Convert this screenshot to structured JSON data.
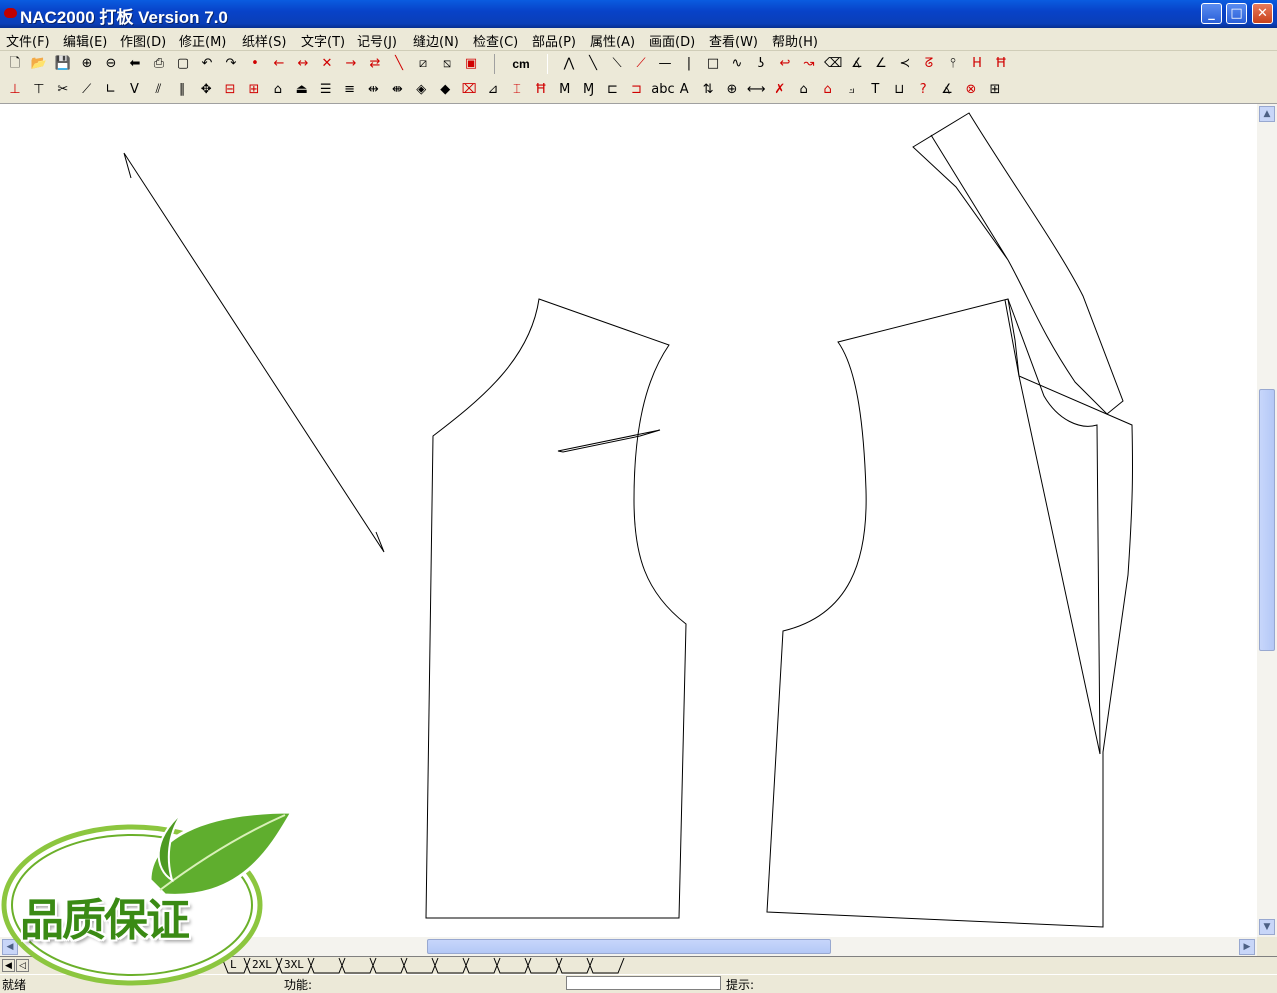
{
  "window": {
    "title": "NAC2000 打板 Version 7.0",
    "minimize": "_",
    "maximize": "□",
    "close": "✕"
  },
  "menu": [
    "文件(F)",
    "编辑(E)",
    "作图(D)",
    "修正(M)",
    "纸样(S)",
    "文字(T)",
    "记号(J)",
    "缝边(N)",
    "检查(C)",
    "部品(P)",
    "属性(A)",
    "画面(D)",
    "查看(W)",
    "帮助(H)"
  ],
  "toolbar1": {
    "tools": [
      {
        "name": "new-file-icon",
        "glyph": "🗋"
      },
      {
        "name": "open-file-icon",
        "glyph": "📂"
      },
      {
        "name": "save-icon",
        "glyph": "💾"
      },
      {
        "name": "zoom-in-icon",
        "glyph": "⊕"
      },
      {
        "name": "zoom-out-icon",
        "glyph": "⊖"
      },
      {
        "name": "back-arrow-icon",
        "glyph": "⬅"
      },
      {
        "name": "print-icon",
        "glyph": "⎙"
      },
      {
        "name": "frame-icon",
        "glyph": "▢"
      },
      {
        "name": "undo-icon",
        "glyph": "↶"
      },
      {
        "name": "redo-icon",
        "glyph": "↷"
      },
      {
        "name": "point-icon",
        "glyph": "•",
        "red": true
      },
      {
        "name": "arrow-left-red-icon",
        "glyph": "←",
        "red": true
      },
      {
        "name": "arrow-cross-red-icon",
        "glyph": "↔",
        "red": true
      },
      {
        "name": "x-red-icon",
        "glyph": "✕",
        "red": true
      },
      {
        "name": "arrow-right-red-icon",
        "glyph": "→",
        "red": true
      },
      {
        "name": "arrows-red-icon",
        "glyph": "⇄",
        "red": true
      },
      {
        "name": "diagonal-red-icon",
        "glyph": "╲",
        "red": true
      },
      {
        "name": "box-diagonal-icon",
        "glyph": "⧄"
      },
      {
        "name": "box-diagonal-2-icon",
        "glyph": "⧅"
      },
      {
        "name": "box-red-icon",
        "glyph": "▣",
        "red": true
      }
    ],
    "unit": "cm",
    "tools_right": [
      {
        "name": "zigzag-icon",
        "glyph": "⋀"
      },
      {
        "name": "slash-icon",
        "glyph": "╲"
      },
      {
        "name": "slash-double-icon",
        "glyph": "⟍"
      },
      {
        "name": "slash-red-icon",
        "glyph": "⟋",
        "red": true
      },
      {
        "name": "horizontal-line-icon",
        "glyph": "—"
      },
      {
        "name": "vertical-line-icon",
        "glyph": "|"
      },
      {
        "name": "rectangle-icon",
        "glyph": "□"
      },
      {
        "name": "curve-icon",
        "glyph": "∿"
      },
      {
        "name": "hook-icon",
        "glyph": "ʖ"
      },
      {
        "name": "curve-red-icon",
        "glyph": "↩",
        "red": true
      },
      {
        "name": "arc-red-icon",
        "glyph": "↝",
        "red": true
      },
      {
        "name": "eraser-icon",
        "glyph": "⌫"
      },
      {
        "name": "angle-icon",
        "glyph": "∡"
      },
      {
        "name": "angle-2-icon",
        "glyph": "∠"
      },
      {
        "name": "check-angle-icon",
        "glyph": "≺"
      },
      {
        "name": "hook-red-icon",
        "glyph": "ᘔ",
        "red": true
      },
      {
        "name": "split-icon",
        "glyph": "⫯"
      },
      {
        "name": "h-measure-red-icon",
        "glyph": "H",
        "red": true
      },
      {
        "name": "h-measure-2-red-icon",
        "glyph": "Ħ",
        "red": true
      }
    ]
  },
  "toolbar2": {
    "tools": [
      {
        "name": "grade-icon",
        "glyph": "⊥",
        "red": true
      },
      {
        "name": "grade-2-icon",
        "glyph": "⊤"
      },
      {
        "name": "scissors-icon",
        "glyph": "✂"
      },
      {
        "name": "line-icon",
        "glyph": "⟋"
      },
      {
        "name": "corner-icon",
        "glyph": "∟"
      },
      {
        "name": "v-icon",
        "glyph": "V"
      },
      {
        "name": "parallel-icon",
        "glyph": "⫽"
      },
      {
        "name": "parallel-2-icon",
        "glyph": "∥"
      },
      {
        "name": "move-icon",
        "glyph": "✥"
      },
      {
        "name": "align-icon",
        "glyph": "⊟",
        "red": true
      },
      {
        "name": "align-2-icon",
        "glyph": "⊞",
        "red": true
      },
      {
        "name": "stack-icon",
        "glyph": "⌂"
      },
      {
        "name": "stack-2-icon",
        "glyph": "⏏"
      },
      {
        "name": "stack-3-icon",
        "glyph": "☰"
      },
      {
        "name": "stack-4-icon",
        "glyph": "≡"
      },
      {
        "name": "mirror-icon",
        "glyph": "⇹"
      },
      {
        "name": "mirror-2-icon",
        "glyph": "⇼"
      },
      {
        "name": "rotate-icon",
        "glyph": "◈"
      },
      {
        "name": "rotate-2-icon",
        "glyph": "◆"
      },
      {
        "name": "piece-icon",
        "glyph": "⌧",
        "red": true
      },
      {
        "name": "fold-icon",
        "glyph": "⊿"
      },
      {
        "name": "notch-red-icon",
        "glyph": "⌶",
        "red": true
      },
      {
        "name": "hm-icon",
        "glyph": "Ħ",
        "red": true
      },
      {
        "name": "m-icon",
        "glyph": "M"
      },
      {
        "name": "m-2-icon",
        "glyph": "Ɱ"
      },
      {
        "name": "block-icon",
        "glyph": "⊏"
      },
      {
        "name": "block-red-icon",
        "glyph": "⊐",
        "red": true
      },
      {
        "name": "abc-icon",
        "glyph": "abc"
      },
      {
        "name": "text-a-icon",
        "glyph": "A"
      },
      {
        "name": "updown-icon",
        "glyph": "⇅"
      },
      {
        "name": "crosshair-icon",
        "glyph": "⊕"
      },
      {
        "name": "measure-icon",
        "glyph": "⟷"
      },
      {
        "name": "cross-red-icon",
        "glyph": "✗",
        "red": true
      },
      {
        "name": "shape-icon",
        "glyph": "⌂"
      },
      {
        "name": "shape-red-icon",
        "glyph": "⌂",
        "red": true
      },
      {
        "name": "curve-ruler-icon",
        "glyph": "⟓"
      },
      {
        "name": "text-t-icon",
        "glyph": "T"
      },
      {
        "name": "ruler-icon",
        "glyph": "⊔"
      },
      {
        "name": "question-red-icon",
        "glyph": "?",
        "red": true
      },
      {
        "name": "angle-measure-icon",
        "glyph": "∡"
      },
      {
        "name": "x-circle-red-icon",
        "glyph": "⊗",
        "red": true
      },
      {
        "name": "grid-icon",
        "glyph": "⊞"
      }
    ]
  },
  "size_tabs": [
    "L",
    "2XL",
    "3XL",
    "",
    "",
    "",
    "",
    "",
    "",
    "",
    "",
    "",
    ""
  ],
  "status": {
    "ready": "就绪",
    "function_label": "功能:",
    "hint_label": "提示:"
  },
  "badge": {
    "text": "品质保证"
  },
  "colors": {
    "titlebar": "#0a47d0",
    "menubar": "#ece9d8",
    "canvas": "#ffffff",
    "badge_green": "#3a8a14"
  }
}
